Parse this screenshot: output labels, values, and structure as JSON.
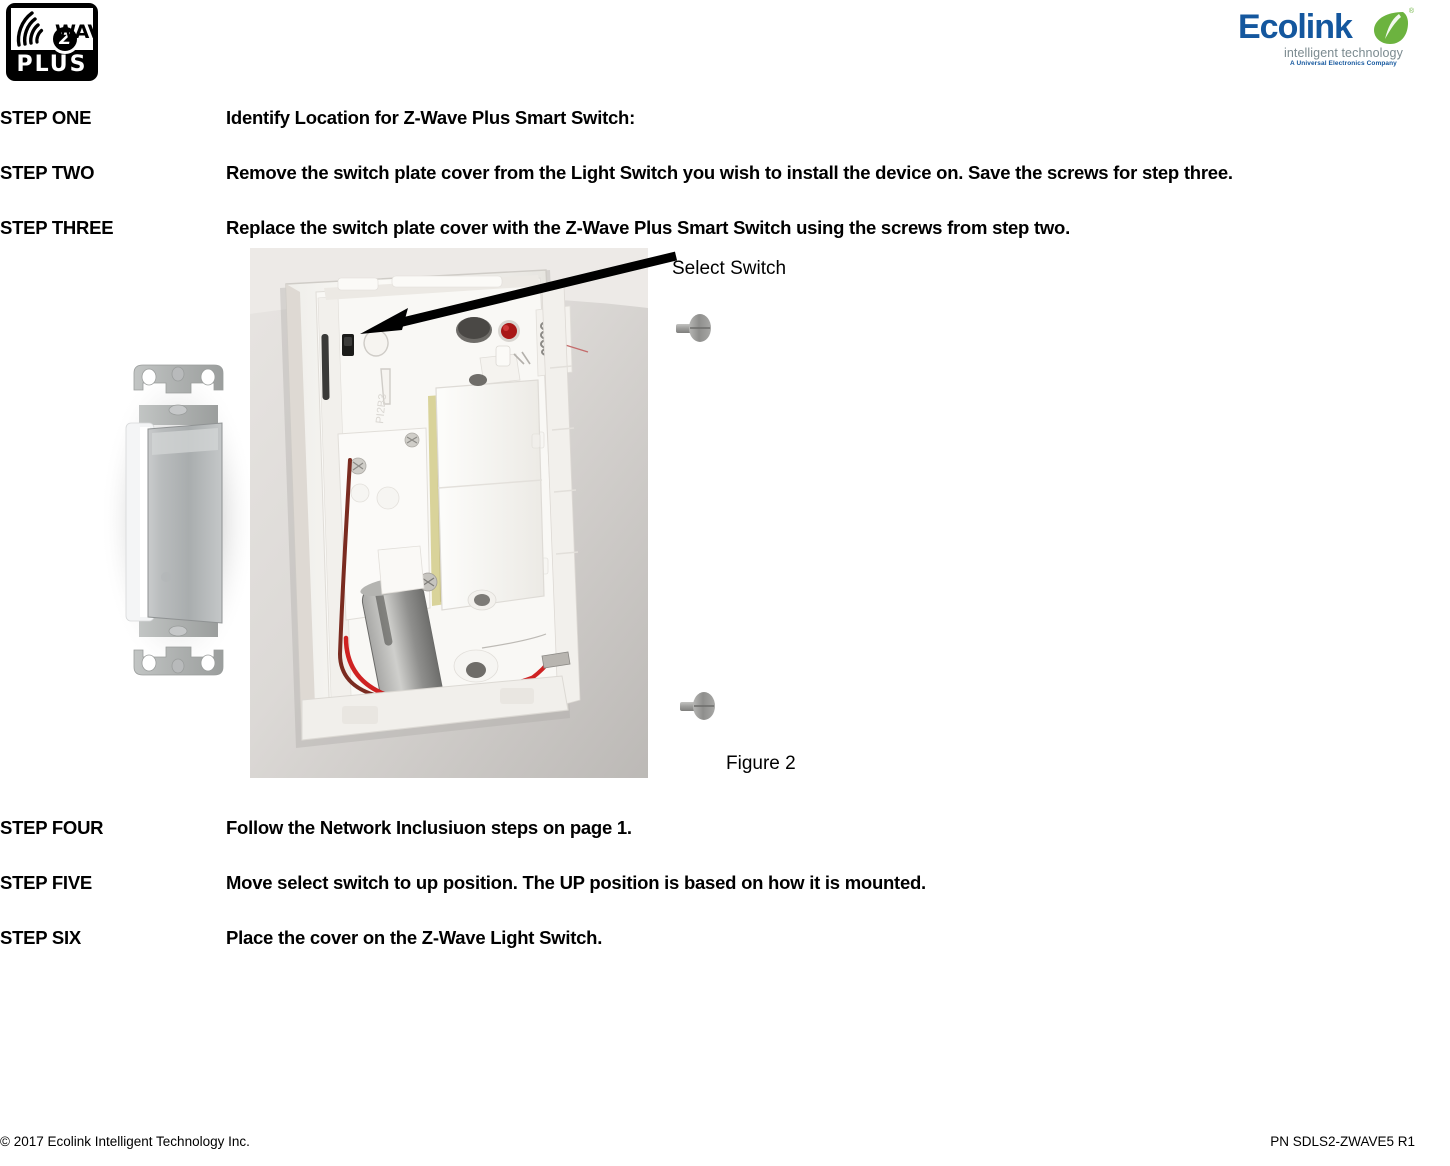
{
  "header": {
    "zwave_logo": {
      "icon": "zwave-signal-icon",
      "badge_letter": "Z",
      "wave_text": "WAVE",
      "plus_text": "PLUS"
    },
    "ecolink_logo": {
      "wordmark": "Ecolink",
      "leaf_icon": "green-leaf-icon",
      "registered_mark": "®",
      "tagline": "intelligent technology",
      "subline": "A Universal Electronics Company",
      "brand_blue": "#14579e",
      "brand_green": "#6cb33f",
      "tagline_gray": "#7b8a8f"
    }
  },
  "steps": [
    {
      "label": "STEP ONE",
      "description": "Identify Location for Z-Wave Plus Smart Switch:"
    },
    {
      "label": "STEP TWO",
      "description": "Remove the switch plate cover from the Light Switch you wish to install the device on. Save the screws for step three."
    },
    {
      "label": "STEP THREE",
      "description": "Replace the switch plate cover with the Z-Wave Plus Smart Switch using the screws from step two."
    },
    {
      "label": "STEP FOUR",
      "description": "Follow the Network Inclusiuon steps on page 1."
    },
    {
      "label": "STEP FIVE",
      "description": "Move select switch to up position.  The UP position is based on how it is mounted."
    },
    {
      "label": "STEP SIX",
      "description": "Place the cover on the Z-Wave Light Switch."
    }
  ],
  "figure": {
    "caption": "Figure 2",
    "annotation_label": "Select Switch",
    "annotation_icon": "arrow-left-icon",
    "decora_switch_icon": "decora-rocker-switch-image",
    "photo_icon": "switch-cover-interior-photo",
    "screw_icon": "screw-icon",
    "screw_count": 2
  },
  "footer": {
    "copyright": "© 2017 Ecolink Intelligent Technology Inc.",
    "part_number": "PN SDLS2-ZWAVE5 R1"
  }
}
